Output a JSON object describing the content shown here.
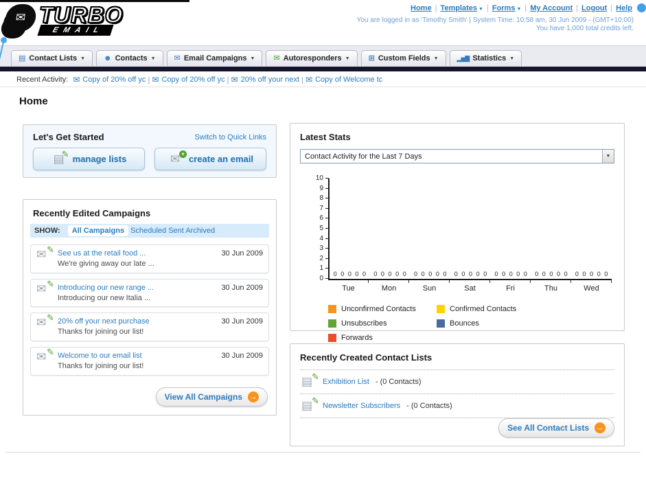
{
  "colors": {
    "link": "#2b7cbf",
    "accent_orange": "#f7941d",
    "nav_dark_bar": "#14152a"
  },
  "header": {
    "logo_title": "TURBO",
    "logo_subtitle": "EMAIL",
    "nav": [
      {
        "label": "Home",
        "dropdown": false
      },
      {
        "label": "Templates",
        "dropdown": true
      },
      {
        "label": "Forms",
        "dropdown": true
      },
      {
        "label": "My Account",
        "dropdown": false
      },
      {
        "label": "Logout",
        "dropdown": false
      },
      {
        "label": "Help",
        "dropdown": false
      }
    ],
    "login_info": "You are logged in as 'Timothy Smith' | System Time: 10:58 am, 30 Jun 2009 - (GMT+10:00)",
    "credits_info": "You have 1,000 total credits left."
  },
  "main_nav": {
    "items": [
      {
        "label": "Contact Lists",
        "icon": "contact-lists-icon"
      },
      {
        "label": "Contacts",
        "icon": "contacts-icon"
      },
      {
        "label": "Email Campaigns",
        "icon": "email-campaigns-icon"
      },
      {
        "label": "Autoresponders",
        "icon": "autoresponders-icon"
      },
      {
        "label": "Custom Fields",
        "icon": "custom-fields-icon"
      },
      {
        "label": "Statistics",
        "icon": "statistics-icon"
      }
    ]
  },
  "recent_activity": {
    "label": "Recent Activity:",
    "items": [
      "Copy of 20% off yc",
      "Copy of 20% off yc",
      "20% off your next",
      "Copy of Welcome tc"
    ]
  },
  "page_title": "Home",
  "get_started": {
    "title": "Let's Get Started",
    "switch_link": "Switch to Quick Links",
    "manage_lists_label": "manage lists",
    "create_email_label": "create an email"
  },
  "campaigns": {
    "title": "Recently Edited Campaigns",
    "show_label": "SHOW:",
    "tabs": [
      {
        "label": "All Campaigns",
        "active": true
      },
      {
        "label": "Scheduled",
        "active": false
      },
      {
        "label": "Sent",
        "active": false
      },
      {
        "label": "Archived",
        "active": false
      }
    ],
    "items": [
      {
        "title": "See us at the retail food ...",
        "subtitle": "We're giving away our late ...",
        "date": "30 Jun 2009"
      },
      {
        "title": "Introducing our new range ...",
        "subtitle": "Introducing our new Italia ...",
        "date": "30 Jun 2009"
      },
      {
        "title": "20% off your next purchase",
        "subtitle": "Thanks for joining our list!",
        "date": "30 Jun 2009"
      },
      {
        "title": "Welcome to our email list",
        "subtitle": "Thanks for joining our list!",
        "date": "30 Jun 2009"
      }
    ],
    "view_all_label": "View All Campaigns"
  },
  "stats": {
    "title": "Latest Stats",
    "filter_value": "Contact Activity for the Last 7 Days"
  },
  "chart_data": {
    "type": "bar",
    "title": "Contact Activity for the Last 7 Days",
    "categories": [
      "Tue",
      "Mon",
      "Sun",
      "Sat",
      "Fri",
      "Thu",
      "Wed"
    ],
    "series": [
      {
        "name": "Unconfirmed Contacts",
        "color": "#f7941d",
        "values": [
          0,
          0,
          0,
          0,
          0,
          0,
          0
        ]
      },
      {
        "name": "Confirmed Contacts",
        "color": "#ffd200",
        "values": [
          0,
          0,
          0,
          0,
          0,
          0,
          0
        ]
      },
      {
        "name": "Unsubscribes",
        "color": "#61a534",
        "values": [
          0,
          0,
          0,
          0,
          0,
          0,
          0
        ]
      },
      {
        "name": "Bounces",
        "color": "#4a6b9d",
        "values": [
          0,
          0,
          0,
          0,
          0,
          0,
          0
        ]
      },
      {
        "name": "Forwards",
        "color": "#e8502a",
        "values": [
          0,
          0,
          0,
          0,
          0,
          0,
          0
        ]
      }
    ],
    "ylim": [
      0,
      10
    ],
    "ytick_step": 1,
    "grid": false,
    "legend_position": "bottom",
    "show_zero_value_labels": true
  },
  "contact_lists": {
    "title": "Recently Created Contact Lists",
    "items": [
      {
        "name": "Exhibition List",
        "detail": "- (0 Contacts)"
      },
      {
        "name": "Newsletter Subscribers",
        "detail": "- (0 Contacts)"
      }
    ],
    "see_all_label": "See All Contact Lists"
  }
}
